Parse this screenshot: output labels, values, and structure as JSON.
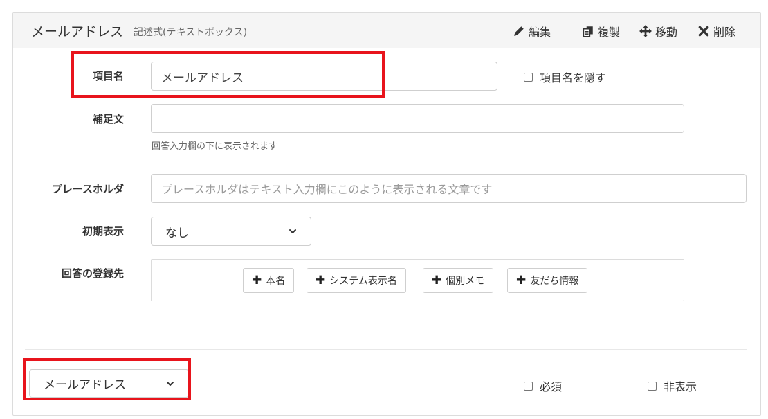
{
  "header": {
    "title": "メールアドレス",
    "subtitle": "記述式(テキストボックス)",
    "actions": [
      {
        "label": "編集",
        "icon": "pencil-icon"
      },
      {
        "label": "複製",
        "icon": "copy-icon"
      },
      {
        "label": "移動",
        "icon": "move-icon"
      },
      {
        "label": "削除",
        "icon": "close-icon"
      }
    ]
  },
  "form": {
    "item_name": {
      "label": "項目名",
      "value": "メールアドレス",
      "hide_label": "項目名を隠す"
    },
    "supplement": {
      "label": "補足文",
      "value": "",
      "help": "回答入力欄の下に表示されます"
    },
    "placeholder": {
      "label": "プレースホルダ",
      "placeholder": "プレースホルダはテキスト入力欄にこのように表示される文章です"
    },
    "initial_display": {
      "label": "初期表示",
      "value": "なし"
    },
    "destination": {
      "label": "回答の登録先",
      "buttons": [
        "本名",
        "システム表示名",
        "個別メモ",
        "友だち情報"
      ]
    }
  },
  "footer": {
    "type_select": "メールアドレス",
    "required_label": "必須",
    "hidden_label": "非表示"
  },
  "colors": {
    "highlight": "#e8141c",
    "header_bg": "#f5f5f5"
  }
}
